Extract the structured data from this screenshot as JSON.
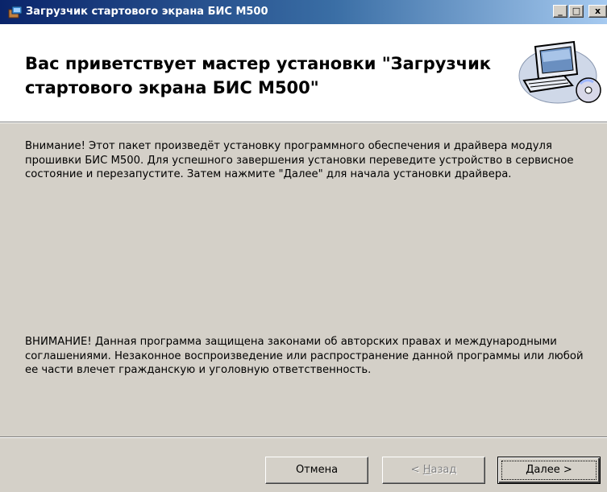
{
  "window": {
    "title": "Загрузчик стартового экрана БИС М500",
    "controls": {
      "minimize": "_",
      "maximize": "□",
      "close": "x"
    }
  },
  "header": {
    "title": "Вас приветствует мастер установки \"Загрузчик стартового экрана БИС М500\"",
    "art_icon": "computer-setup-icon"
  },
  "notices": {
    "notice1": "Внимание! Этот пакет произведёт установку программного обеспечения и драйвера модуля прошивки БИС M500. Для успешного завершения установки переведите устройство в сервисное состояние и перезапустите. Затем нажмите \"Далее\" для начала установки драйвера.",
    "notice2": "ВНИМАНИЕ! Данная программа защищена законами об авторских правах и международными соглашениями. Незаконное воспроизведение или распространение данной программы или любой ее части влечет гражданскую и уголовную ответственность."
  },
  "buttons": {
    "cancel": "Отмена",
    "back_prefix": "< ",
    "back_hotkey": "Н",
    "back_rest": "азад",
    "next_hotkey": "Д",
    "next_rest": "алее >"
  }
}
